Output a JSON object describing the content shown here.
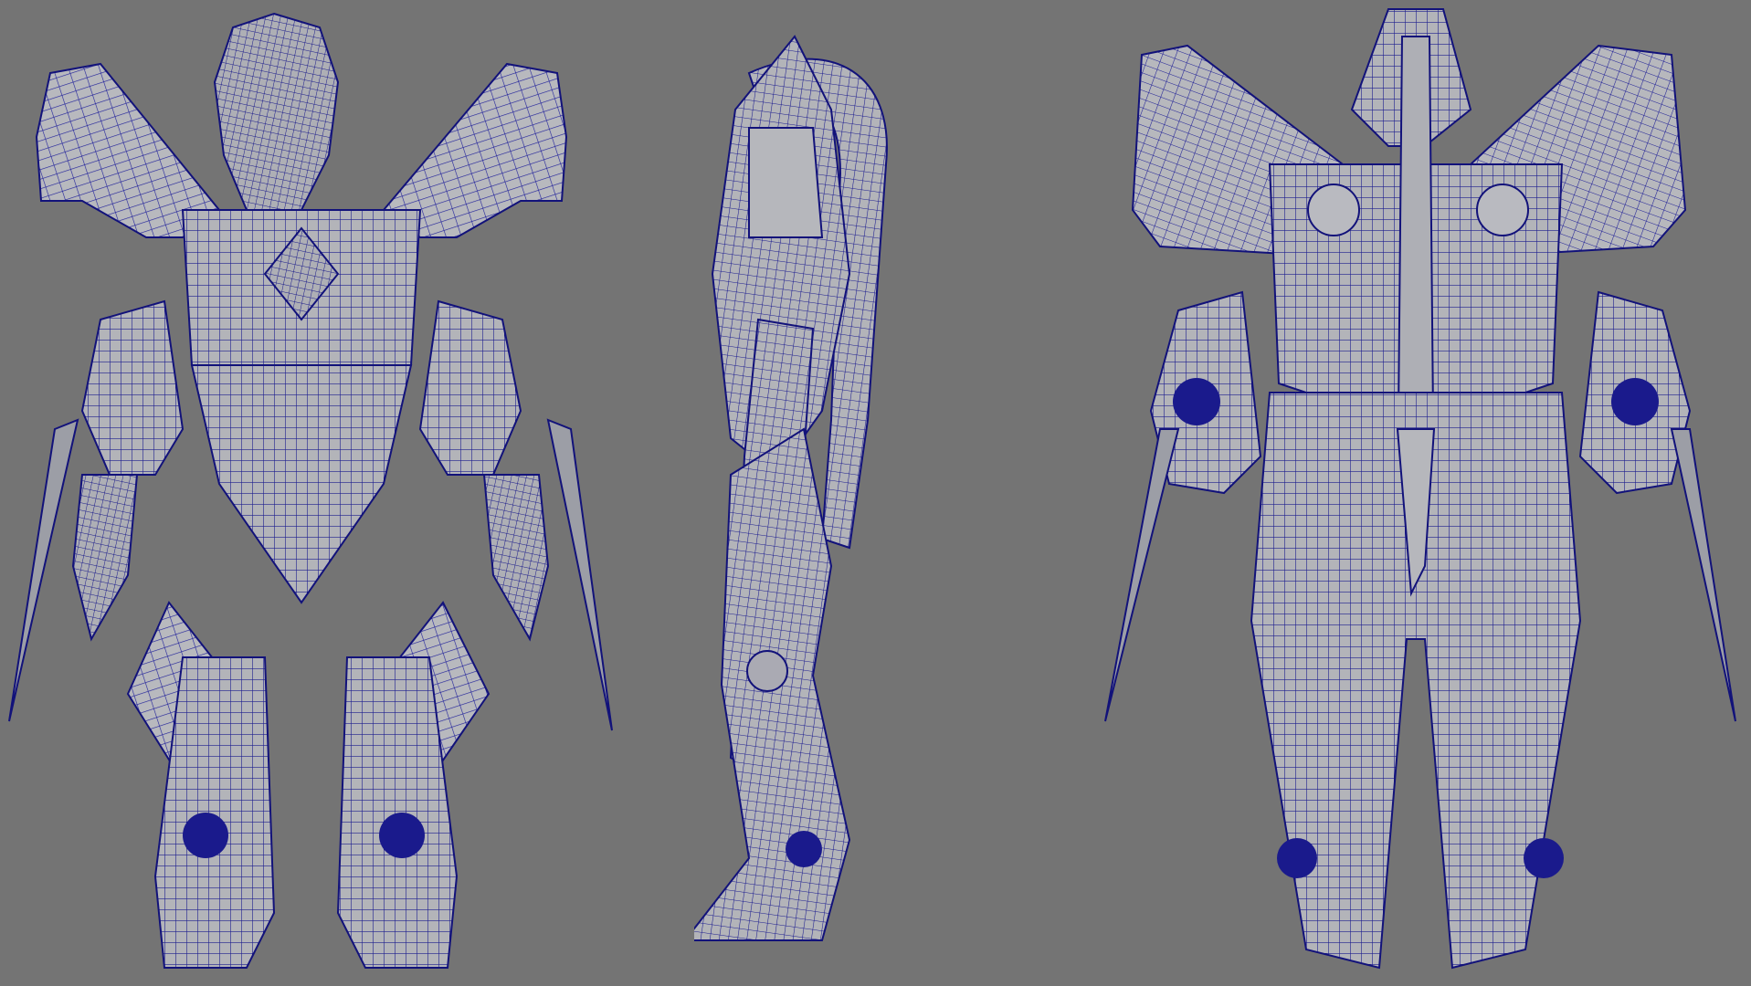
{
  "viewport": {
    "background_color": "#747474",
    "wire_color": "#1a1a8c",
    "surface_color": "#b2b3b8",
    "views": [
      "front",
      "side",
      "back"
    ]
  }
}
